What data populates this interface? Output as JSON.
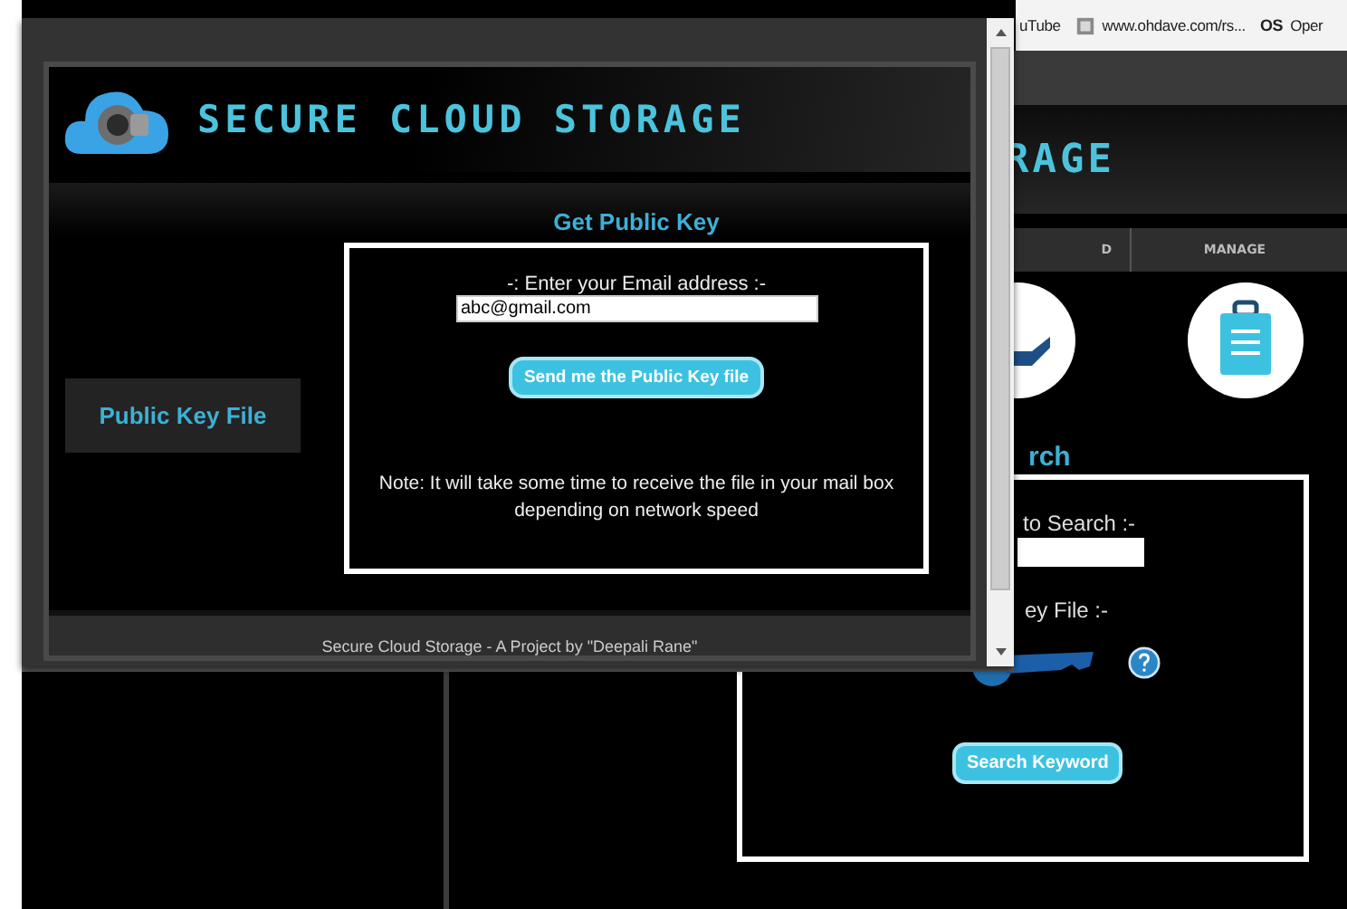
{
  "browser": {
    "bookmarks": [
      {
        "kind": "plain",
        "label": "uTube"
      },
      {
        "kind": "favicon",
        "label": "www.ohdave.com/rs..."
      },
      {
        "kind": "badge",
        "badge": "OS",
        "label": "Oper"
      }
    ]
  },
  "background_page": {
    "title": "RAGE",
    "nav": [
      "D",
      "MANAGE"
    ],
    "section_heading": "rch",
    "search_label": "to Search :-",
    "key_label": "ey File :-",
    "button": "Search Keyword"
  },
  "popup": {
    "title": "SECURE CLOUD STORAGE",
    "side_button": "Public Key File",
    "heading": "Get Public Key",
    "email_label": "-: Enter your Email address :-",
    "email": {
      "value": "abc@gmail.com"
    },
    "send_button": "Send me the Public Key file",
    "note": "Note: It will take some time to receive the file in your mail box depending on network speed",
    "footer": "Secure Cloud Storage - A Project by \"Deepali Rane\""
  }
}
